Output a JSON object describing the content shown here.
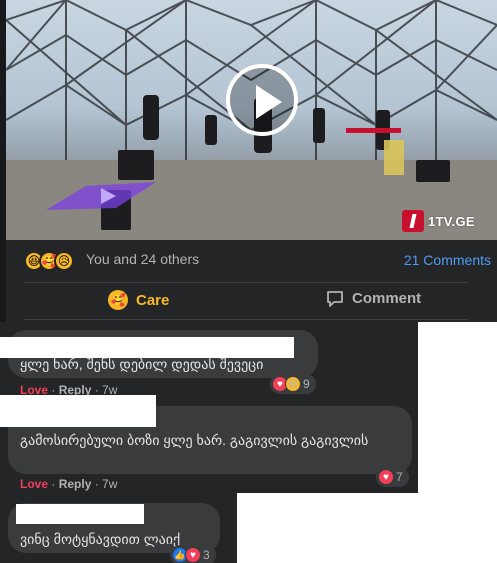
{
  "post": {
    "channel_logo_text": "1TV.GE",
    "reactions_text": "You and 24 others",
    "comments_count": "21 Comments",
    "actions": {
      "care_label": "Care",
      "comment_label": "Comment"
    }
  },
  "comments": [
    {
      "text": "ყლე ხარ, შენს დებილ დედას შევეცი",
      "reaction_label": "Love",
      "reply_label": "Reply",
      "time": "7w",
      "reaction_count": "9"
    },
    {
      "text": "გამოსირებული ბოზი ყლე ხარ. გაგივლის გაგივლის",
      "reaction_label": "Love",
      "reply_label": "Reply",
      "time": "7w",
      "reaction_count": "7"
    },
    {
      "text": "ვინც მოტყნავდით ლაიქ",
      "reaction_count": "3"
    }
  ],
  "colors": {
    "card_bg": "#242526",
    "bubble_bg": "#3a3b3c",
    "link_blue": "#4e9cf5",
    "love_red": "#f33e58",
    "care_yellow": "#f7b928"
  }
}
